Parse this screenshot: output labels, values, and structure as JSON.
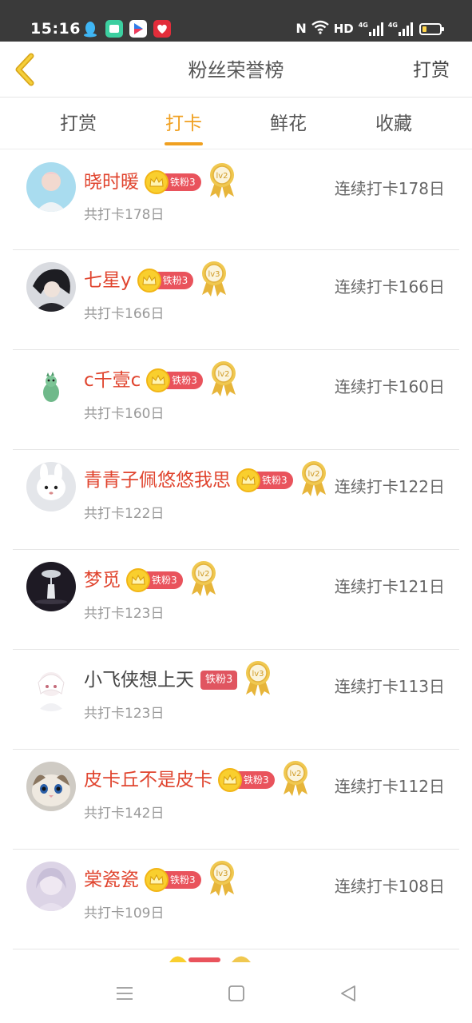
{
  "status_bar": {
    "time": "15:16",
    "nfc": "N",
    "hd": "HD",
    "net1": "4G",
    "net2": "4G"
  },
  "header": {
    "title": "粉丝荣誉榜",
    "action_label": "打赏"
  },
  "tabs": [
    {
      "label": "打赏",
      "active": false
    },
    {
      "label": "打卡",
      "active": true
    },
    {
      "label": "鲜花",
      "active": false
    },
    {
      "label": "收藏",
      "active": false
    }
  ],
  "colors": {
    "accent": "#f0a020",
    "vip_name": "#e0442e",
    "badge_red": "#e9535c",
    "status_bar": "#3a3a3a"
  },
  "rows": [
    {
      "name": "晓时暖",
      "vip": true,
      "badge": "铁粉3",
      "medal": "lv2",
      "total": "共打卡178日",
      "streak": "连续打卡178日"
    },
    {
      "name": "七星y",
      "vip": true,
      "badge": "铁粉3",
      "medal": "lv3",
      "total": "共打卡166日",
      "streak": "连续打卡166日"
    },
    {
      "name": "c千壹c",
      "vip": true,
      "badge": "铁粉3",
      "medal": "lv2",
      "total": "共打卡160日",
      "streak": "连续打卡160日"
    },
    {
      "name": "青青子佩悠悠我思",
      "vip": true,
      "badge": "铁粉3",
      "medal": "lv2",
      "total": "共打卡122日",
      "streak": "连续打卡122日"
    },
    {
      "name": "梦觅",
      "vip": true,
      "badge": "铁粉3",
      "medal": "lv2",
      "total": "共打卡123日",
      "streak": "连续打卡121日"
    },
    {
      "name": "小飞侠想上天",
      "vip": false,
      "badge": "铁粉3",
      "medal": "lv3",
      "total": "共打卡123日",
      "streak": "连续打卡113日"
    },
    {
      "name": "皮卡丘不是皮卡",
      "vip": true,
      "badge": "铁粉3",
      "medal": "lv2",
      "total": "共打卡142日",
      "streak": "连续打卡112日"
    },
    {
      "name": "棠瓷瓷",
      "vip": true,
      "badge": "铁粉3",
      "medal": "lv3",
      "total": "共打卡109日",
      "streak": "连续打卡108日"
    }
  ],
  "icons": {
    "back": "chevron-left-icon",
    "crown": "crown-icon",
    "medal": "medal-icon",
    "nav_menu": "menu-icon",
    "nav_home": "home-square-icon",
    "nav_back": "triangle-back-icon"
  }
}
